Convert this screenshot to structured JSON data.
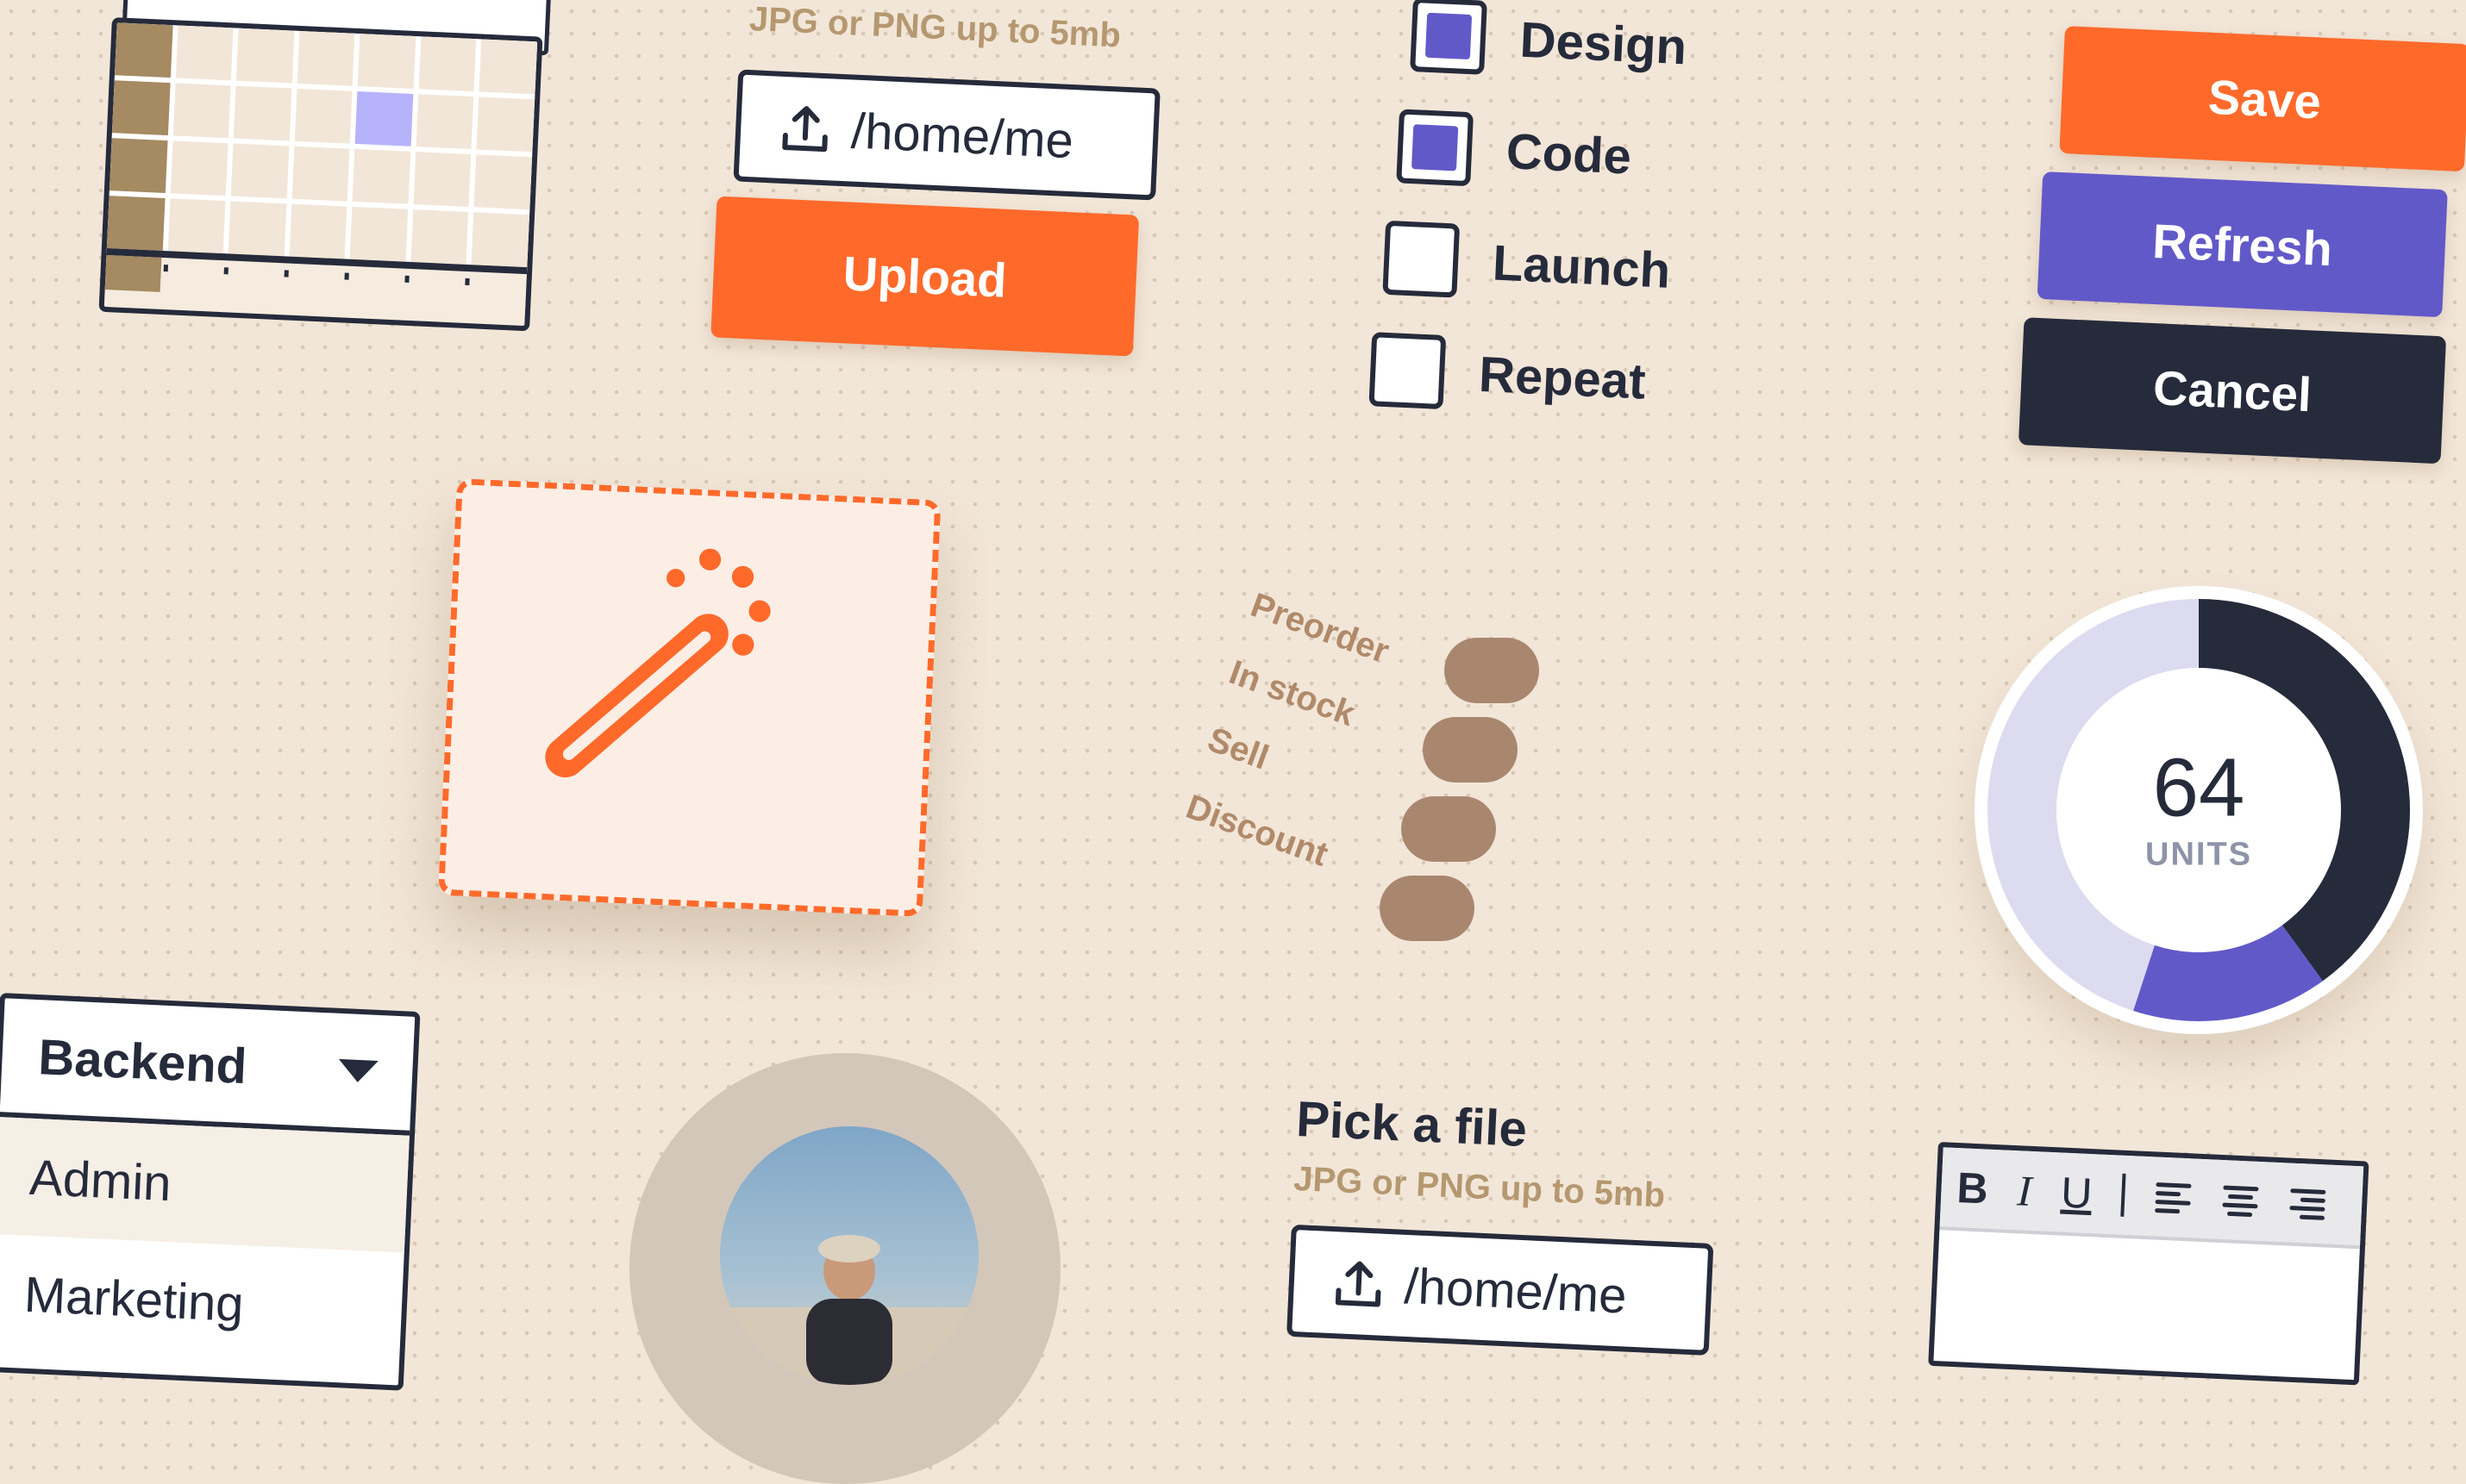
{
  "calendar": {
    "rows": 5,
    "cols": 7,
    "highlight": {
      "row": 1,
      "col": 4
    }
  },
  "upload_top": {
    "hint": "JPG or PNG up to 5mb",
    "path_value": "/home/me",
    "upload_label": "Upload"
  },
  "checkboxes": [
    {
      "label": "Design",
      "checked": true
    },
    {
      "label": "Code",
      "checked": true
    },
    {
      "label": "Launch",
      "checked": false
    },
    {
      "label": "Repeat",
      "checked": false
    }
  ],
  "actions": {
    "save": "Save",
    "refresh": "Refresh",
    "cancel": "Cancel"
  },
  "drop_zone": {
    "icon": "magic-wand-icon"
  },
  "toggles": [
    {
      "label": "Preorder",
      "on": true
    },
    {
      "label": "In stock",
      "on": true
    },
    {
      "label": "Sell",
      "on": true
    },
    {
      "label": "Discount",
      "on": true
    }
  ],
  "donut": {
    "value": "64",
    "unit": "UNITS",
    "segments": [
      {
        "name": "dark",
        "fraction": 0.4,
        "color": "#262b3b"
      },
      {
        "name": "purple",
        "fraction": 0.15,
        "color": "#6259c9"
      },
      {
        "name": "lavender",
        "fraction": 0.45,
        "color": "#dddbf0"
      }
    ]
  },
  "dropdown": {
    "selected": "Backend",
    "options": [
      "Admin",
      "Marketing"
    ]
  },
  "file_picker": {
    "title": "Pick a file",
    "hint": "JPG or PNG up to 5mb",
    "path_value": "/home/me"
  },
  "editor": {
    "bold": "B",
    "italic": "I",
    "underline": "U"
  },
  "colors": {
    "background": "#f2e6d8",
    "orange": "#ff6a2b",
    "purple": "#6259c9",
    "dark": "#262b3b",
    "tan": "#a9876f"
  }
}
